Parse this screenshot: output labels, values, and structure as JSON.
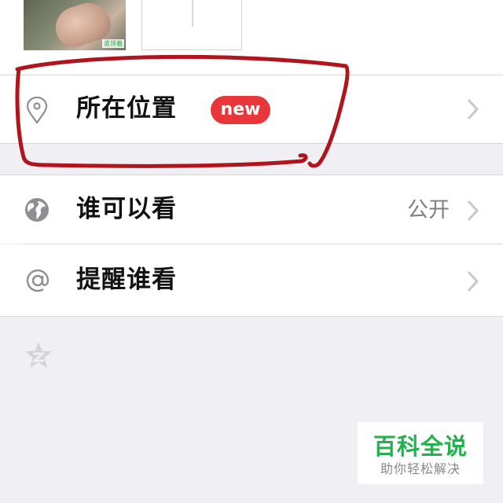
{
  "photos": {
    "watermark": "谁领着"
  },
  "rows": {
    "location": {
      "label": "所在位置",
      "badge": "new"
    },
    "visibility": {
      "label": "谁可以看",
      "value": "公开"
    },
    "remind": {
      "label": "提醒谁看"
    }
  },
  "icons": {
    "location": "location-pin-icon",
    "visibility": "globe-icon",
    "remind": "at-sign-icon",
    "qzone": "qzone-star-icon",
    "chevron": "chevron-right-icon"
  },
  "colors": {
    "badge": "#e8363a",
    "annotation": "#b0141c",
    "watermark_green": "#23b04d"
  },
  "watermark": {
    "title": "百科全说",
    "subtitle": "助你轻松解决"
  }
}
